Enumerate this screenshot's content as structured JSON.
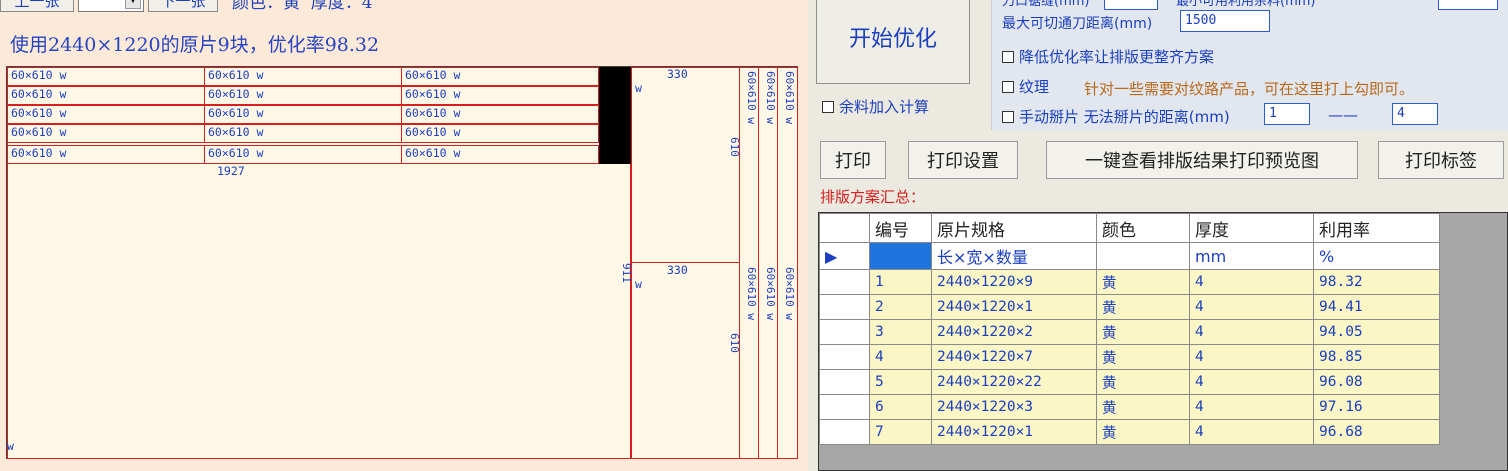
{
  "toolbar": {
    "prev_label": "上一张",
    "next_label": "下一张",
    "page_value": "",
    "info": "颜色：黄  厚度：4"
  },
  "summary_line": "使用2440×1220的原片9块，优化率98.32",
  "layout": {
    "piece_label": "60×610 w",
    "bottom_dim": "1927",
    "height_dim": "911",
    "col_dim_top": "330",
    "col_dim_bottom": "330",
    "strip_dim": "610",
    "strip_piece": "60×610 w",
    "corner_mark": "w"
  },
  "controls": {
    "start_button": "开始优化",
    "remnant_label": "余料加入计算",
    "knife_gap_label": "刀口锯缝(mm)",
    "min_usable_label": "最小可用利用余料(mm)",
    "max_cut_label": "最大可切通刀距离(mm)",
    "max_cut_value": "1500",
    "reduce_label": "降低优化率让排版更整齐方案",
    "texture_label": "纹理",
    "texture_note": "针对一些需要对纹路产品，可在这里打上勾即可。",
    "manual_label": "手动掰片 无法掰片的距离(mm)",
    "manual_from": "1",
    "manual_sep": "——",
    "manual_to": "4"
  },
  "buttons": {
    "print": "打印",
    "print_settings": "打印设置",
    "preview": "一键查看排版结果打印预览图",
    "print_label": "打印标签"
  },
  "summary_title": "排版方案汇总：",
  "table": {
    "headers": [
      "编号",
      "原片规格",
      "颜色",
      "厚度",
      "利用率"
    ],
    "units": [
      "",
      "长×宽×数量",
      "",
      "mm",
      "%"
    ],
    "rows": [
      [
        "1",
        "2440×1220×9",
        "黄",
        "4",
        "98.32"
      ],
      [
        "2",
        "2440×1220×1",
        "黄",
        "4",
        "94.41"
      ],
      [
        "3",
        "2440×1220×2",
        "黄",
        "4",
        "94.05"
      ],
      [
        "4",
        "2440×1220×7",
        "黄",
        "4",
        "98.85"
      ],
      [
        "5",
        "2440×1220×22",
        "黄",
        "4",
        "96.08"
      ],
      [
        "6",
        "2440×1220×3",
        "黄",
        "4",
        "97.16"
      ],
      [
        "7",
        "2440×1220×1",
        "黄",
        "4",
        "96.68"
      ]
    ]
  }
}
